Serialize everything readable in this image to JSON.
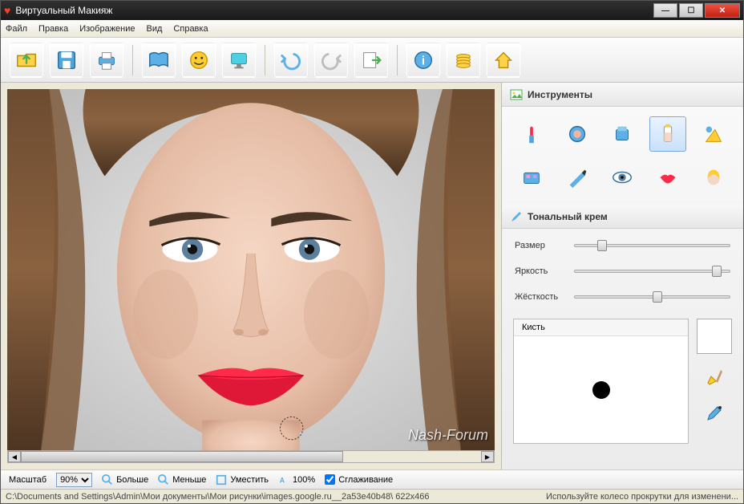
{
  "window": {
    "title": "Виртуальный Макияж"
  },
  "menu": {
    "file": "Файл",
    "edit": "Правка",
    "image": "Изображение",
    "view": "Вид",
    "help": "Справка"
  },
  "toolbar_icons": {
    "open": "open-icon",
    "save": "save-icon",
    "print": "print-icon",
    "book": "book-icon",
    "face": "face-icon",
    "screen": "screen-icon",
    "undo": "undo-icon",
    "redo": "redo-icon",
    "export": "export-icon",
    "info": "info-icon",
    "coins": "coins-icon",
    "home": "home-icon"
  },
  "panels": {
    "tools_header": "Инструменты",
    "foundation_header": "Тональный крем",
    "tools": [
      {
        "name": "lipstick-icon"
      },
      {
        "name": "blush-icon"
      },
      {
        "name": "powder-icon"
      },
      {
        "name": "foundation-icon",
        "selected": true
      },
      {
        "name": "tan-icon"
      },
      {
        "name": "eyeshadow-icon"
      },
      {
        "name": "eyeliner-icon"
      },
      {
        "name": "eye-icon"
      },
      {
        "name": "lips-icon"
      },
      {
        "name": "hair-icon"
      }
    ]
  },
  "sliders": {
    "size": {
      "label": "Размер",
      "value": 15
    },
    "brightness": {
      "label": "Яркость",
      "value": 88
    },
    "hardness": {
      "label": "Жёсткость",
      "value": 50
    }
  },
  "brush": {
    "tab": "Кисть"
  },
  "bottom": {
    "scale_label": "Масштаб",
    "scale_value": "90%",
    "zoom_in": "Больше",
    "zoom_out": "Меньше",
    "fit": "Уместить",
    "hundred": "100%",
    "smoothing": "Сглаживание",
    "smoothing_checked": true
  },
  "status": {
    "path": "C:\\Documents and Settings\\Admin\\Мои документы\\Мои рисунки\\images.google.ru__2a53e40b48\\ 622x466",
    "hint": "Используйте колесо прокрутки для изменени..."
  },
  "watermark": "Nash-Forum"
}
